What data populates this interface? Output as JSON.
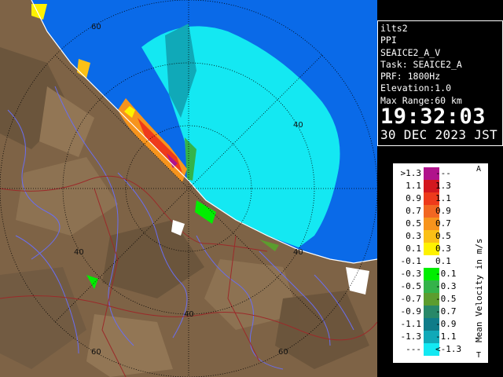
{
  "radar": {
    "site": "ilts2",
    "product": "PPI",
    "scan": "SEAICE2_A_V",
    "task": "Task: SEAICE2_A",
    "prf": "PRF: 1800Hz",
    "elevation": "Elevation:1.0",
    "max_range": "Max Range:60 km",
    "time": "19:32:03",
    "date": "30 DEC 2023 JST"
  },
  "range_labels": {
    "ring40_top": "40",
    "ring40_right": "40",
    "ring40_bottom": "40",
    "ring40_left": "40",
    "ring60_topleft": "60",
    "ring60_bottomleft": "60",
    "ring60_bottomright": "60"
  },
  "legend": {
    "unit": "Mean Velocity in m/s",
    "top_mark": "A",
    "bottom_mark": "T",
    "entries": [
      {
        "low": ">1.3",
        "high": "---",
        "color": "#b0138b"
      },
      {
        "low": "1.1",
        "high": "1.3",
        "color": "#d3171f"
      },
      {
        "low": "0.9",
        "high": "1.1",
        "color": "#ee3a1b"
      },
      {
        "low": "0.7",
        "high": "0.9",
        "color": "#f26722"
      },
      {
        "low": "0.5",
        "high": "0.7",
        "color": "#f7941d"
      },
      {
        "low": "0.3",
        "high": "0.5",
        "color": "#fbc016"
      },
      {
        "low": "0.1",
        "high": "0.3",
        "color": "#fef200"
      },
      {
        "low": "-0.1",
        "high": "0.1",
        "color": "#ffffff"
      },
      {
        "low": "-0.3",
        "high": "-0.1",
        "color": "#00ee00"
      },
      {
        "low": "-0.5",
        "high": "-0.3",
        "color": "#34b34a"
      },
      {
        "low": "-0.7",
        "high": "-0.5",
        "color": "#5c9d2e"
      },
      {
        "low": "-0.9",
        "high": "-0.7",
        "color": "#288868"
      },
      {
        "low": "-1.1",
        "high": "-0.9",
        "color": "#0f7c89"
      },
      {
        "low": "-1.3",
        "high": "-1.1",
        "color": "#10a9b8"
      },
      {
        "low": "---",
        "high": "<-1.3",
        "color": "#14e8f2"
      }
    ]
  },
  "colors": {
    "sea": "#0a6ae8",
    "land": "#7e6346",
    "river": "#6a6ef0",
    "boundary": "#9b2a2a",
    "range_ring": "#000000",
    "echo_main": "#14e8f2"
  }
}
